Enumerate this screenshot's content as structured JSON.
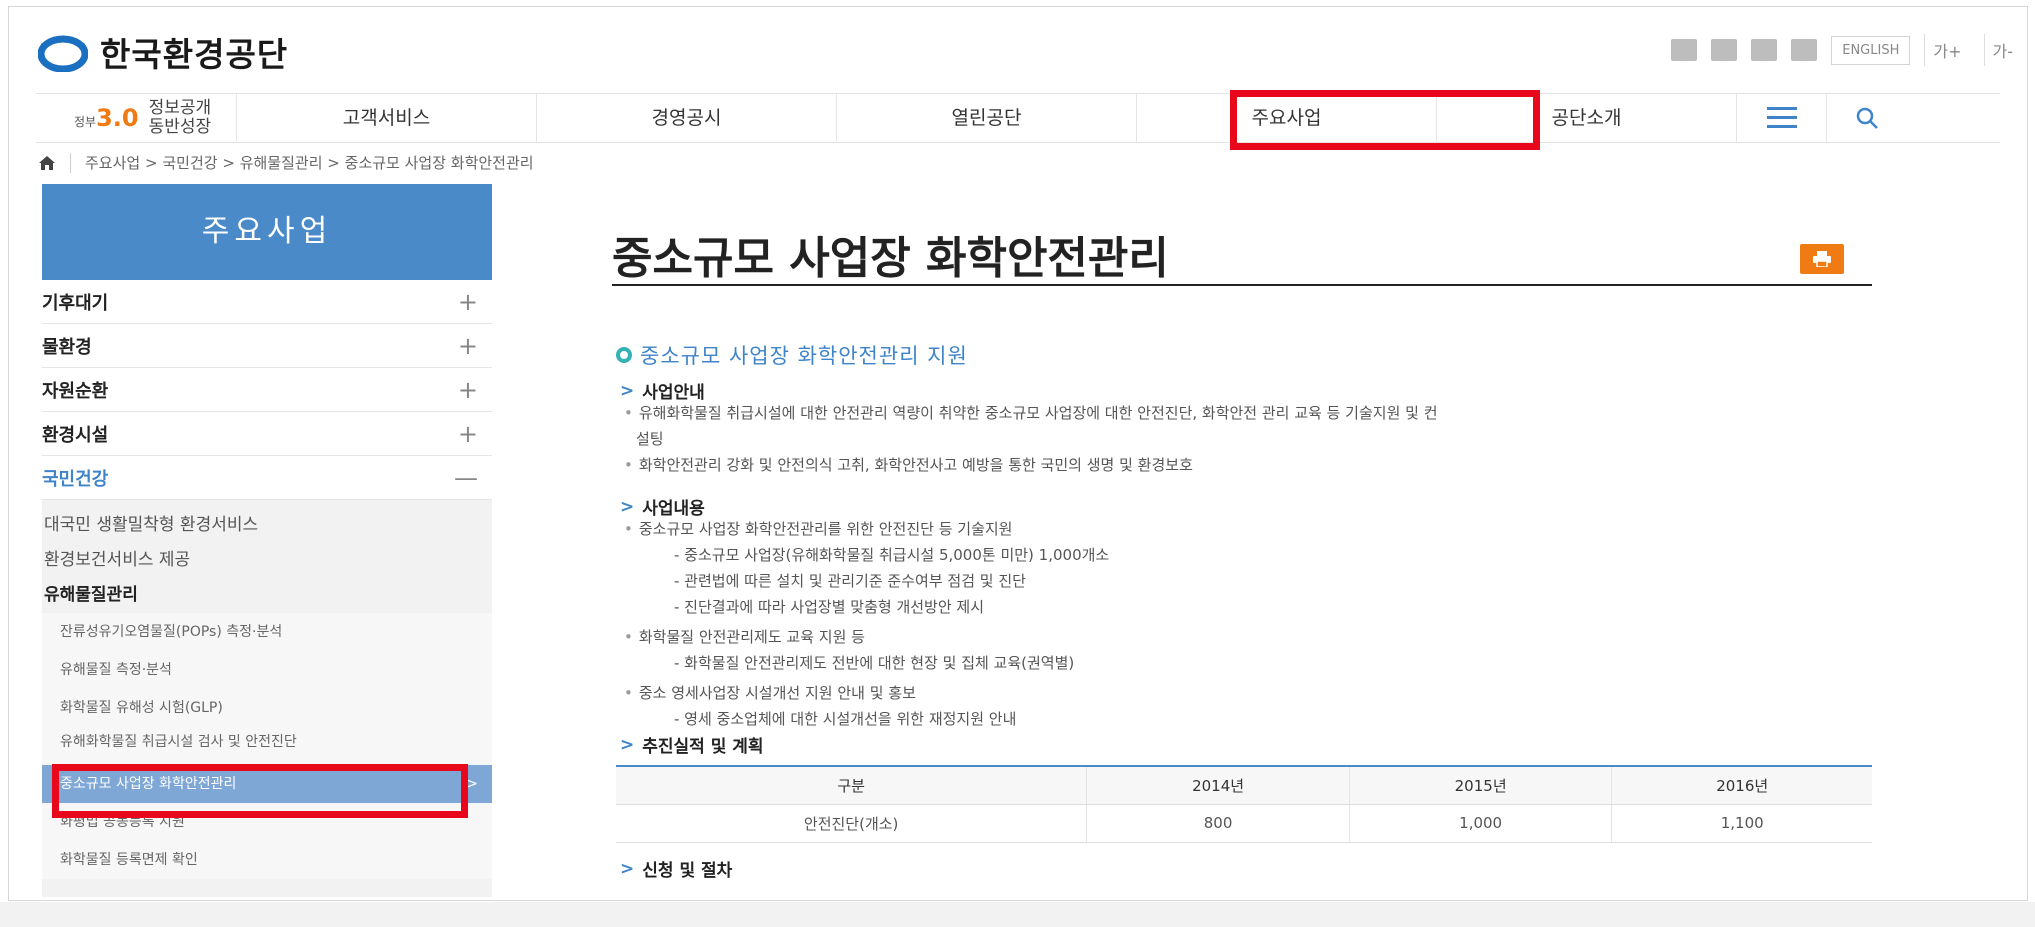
{
  "header": {
    "logo_text": "한국환경공단",
    "english_label": "ENGLISH",
    "font_larger": "가+",
    "font_smaller": "가-",
    "accent_color": "#e8071b",
    "brand_color": "#4b8ac8"
  },
  "gnb": {
    "gov30_badge": "정부",
    "gov30_number": "3.0",
    "gov30_text_line1": "정보공개",
    "gov30_text_line2": "동반성장",
    "items": [
      "고객서비스",
      "경영공시",
      "열린공단",
      "주요사업",
      "공단소개"
    ]
  },
  "breadcrumb": [
    "주요사업",
    "국민건강",
    "유해물질관리",
    "중소규모 사업장 화학안전관리"
  ],
  "breadcrumb_sep": ">",
  "sidebar": {
    "title": "주요사업",
    "categories": [
      {
        "label": "기후대기",
        "state": "+"
      },
      {
        "label": "물환경",
        "state": "+"
      },
      {
        "label": "자원순환",
        "state": "+"
      },
      {
        "label": "환경시설",
        "state": "+"
      },
      {
        "label": "국민건강",
        "state": "—"
      }
    ],
    "sub_items": [
      "대국민 생활밀착형 환경서비스",
      "환경보건서비스 제공",
      "유해물질관리"
    ],
    "sub_sub_items": [
      "잔류성유기오염물질(POPs) 측정·분석",
      "유해물질 측정·분석",
      "화학물질 유해성 시험(GLP)",
      "유해화학물질 취급시설 검사 및 안전진단",
      "중소규모 사업장 화학안전관리",
      "화평법 공동등록 지원",
      "화학물질 등록면제 확인"
    ],
    "active_arrow": ">"
  },
  "content": {
    "page_title": "중소규모 사업장 화학안전관리",
    "section_title": "중소규모 사업장 화학안전관리 지원",
    "h_intro": "사업안내",
    "intro_1": "유해화학물질 취급시설에 대한 안전관리 역량이 취약한 중소규모 사업장에 대한 안전진단, 화학안전 관리 교육 등 기술지원 및 컨",
    "intro_1b": "설팅",
    "intro_2": "화학안전관리 강화 및 안전의식 고취, 화학안전사고 예방을 통한 국민의 생명 및 환경보호",
    "h_content": "사업내용",
    "c1": "중소규모 사업장 화학안전관리를 위한 안전진단 등 기술지원",
    "c1_a": "- 중소규모 사업장(유해화학물질 취급시설 5,000톤 미만) 1,000개소",
    "c1_b": "- 관련법에 따른 설치 및 관리기준 준수여부 점검 및 진단",
    "c1_c": "- 진단결과에 따라 사업장별 맞춤형 개선방안 제시",
    "c2": "화학물질 안전관리제도 교육 지원 등",
    "c2_a": "- 화학물질 안전관리제도 전반에 대한 현장 및 집체 교육(권역별)",
    "c3": "중소 영세사업장 시설개선 지원 안내 및 홍보",
    "c3_a": "- 영세 중소업체에 대한 시설개선을 위한 재정지원 안내",
    "h_plan": "추진실적 및 계획",
    "table_headers": [
      "구분",
      "2014년",
      "2015년",
      "2016년"
    ],
    "table_row": [
      "안전진단(개소)",
      "800",
      "1,000",
      "1,100"
    ],
    "h_apply": "신청 및 절차"
  }
}
